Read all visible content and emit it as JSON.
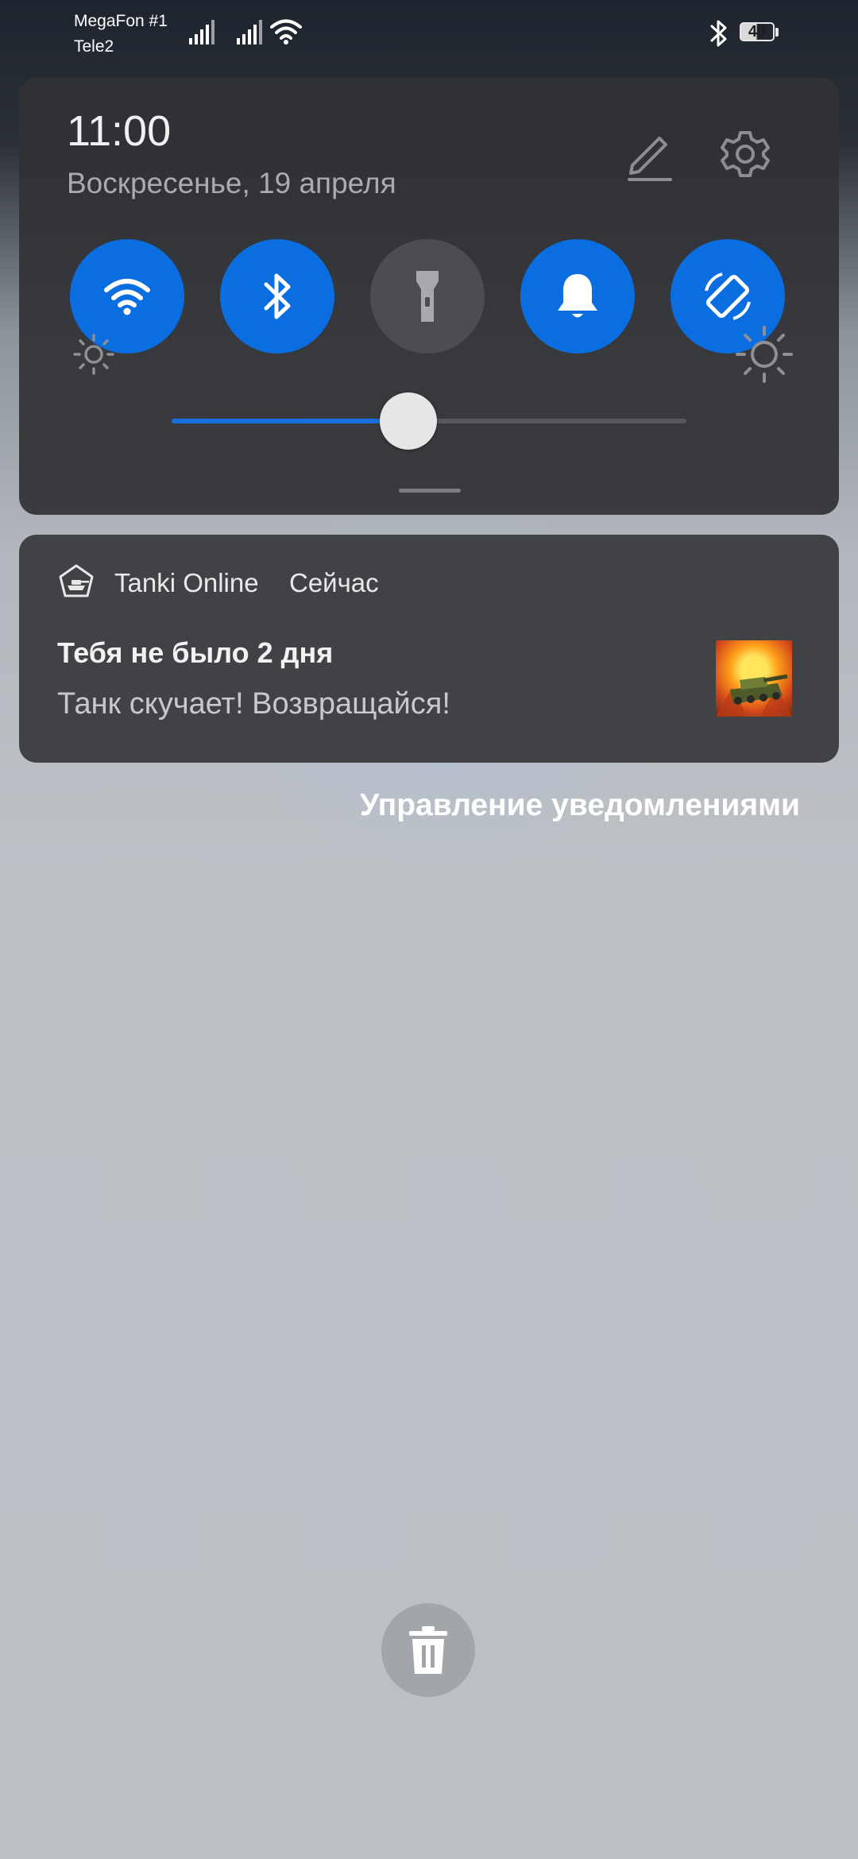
{
  "status_bar": {
    "carrier1": "MegaFon #1",
    "carrier2": "Tele2",
    "battery_percent": "49",
    "icons": [
      "signal-icon",
      "signal-icon",
      "wifi-icon",
      "bluetooth-icon",
      "battery-icon"
    ]
  },
  "quick_settings": {
    "time": "11:00",
    "date": "Воскресенье, 19 апреля",
    "tiles": [
      {
        "name": "wifi",
        "icon": "wifi-icon",
        "state": "on"
      },
      {
        "name": "bluetooth",
        "icon": "bluetooth-icon",
        "state": "on"
      },
      {
        "name": "flashlight",
        "icon": "flashlight-icon",
        "state": "off"
      },
      {
        "name": "sound",
        "icon": "bell-icon",
        "state": "on"
      },
      {
        "name": "auto-rotate",
        "icon": "rotate-icon",
        "state": "on"
      }
    ],
    "brightness_level": 0.46,
    "accent_color": "#0a6ee0"
  },
  "notification": {
    "app_name": "Tanki Online",
    "time": "Сейчас",
    "title": "Тебя не было 2 дня",
    "text": "Танк скучает! Возвращайся!"
  },
  "manage_notifications": "Управление уведомлениями"
}
